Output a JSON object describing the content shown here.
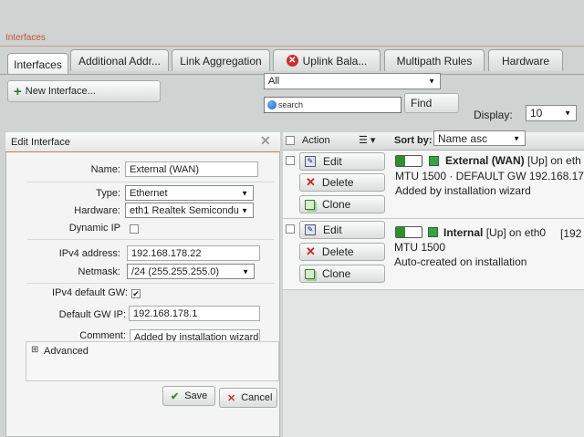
{
  "window": {
    "title": "Interfaces"
  },
  "tabs": [
    {
      "label": "Interfaces"
    },
    {
      "label": "Additional Addr..."
    },
    {
      "label": "Link Aggregation"
    },
    {
      "label": "Uplink Bala..."
    },
    {
      "label": "Multipath Rules"
    },
    {
      "label": "Hardware"
    }
  ],
  "toolbar": {
    "new_interface_label": "New Interface...",
    "filter_value": "All",
    "search_placeholder": "search",
    "find_label": "Find",
    "display_label": "Display:",
    "display_value": "10"
  },
  "edit_panel": {
    "title": "Edit Interface",
    "fields": {
      "name": {
        "label": "Name:",
        "value": "External (WAN)"
      },
      "type": {
        "label": "Type:",
        "value": "Ethernet"
      },
      "hardware": {
        "label": "Hardware:",
        "value": "eth1 Realtek Semicondu"
      },
      "dynamic_ip": {
        "label": "Dynamic IP",
        "checked": false
      },
      "ipv4_address": {
        "label": "IPv4 address:",
        "value": "192.168.178.22"
      },
      "netmask": {
        "label": "Netmask:",
        "value": "/24 (255.255.255.0)"
      },
      "ipv4_default_gw": {
        "label": "IPv4 default GW:",
        "checked": true,
        "check_glyph": "✔"
      },
      "default_gw_ip": {
        "label": "Default GW IP:",
        "value": "192.168.178.1"
      },
      "comment": {
        "label": "Comment:",
        "value": "Added by installation wizard"
      }
    },
    "advanced_label": "Advanced",
    "advanced_expander": "⊞",
    "save_label": "Save",
    "cancel_label": "Cancel"
  },
  "list": {
    "action_header": "Action",
    "sort_by_label": "Sort by:",
    "sort_value": "Name asc",
    "rows": [
      {
        "edit_label": "Edit",
        "delete_label": "Delete",
        "clone_label": "Clone",
        "name": "External (WAN)",
        "status": "[Up] on eth",
        "line2": "MTU 1500 · DEFAULT GW 192.168.17",
        "line3": "Added by installation wizard"
      },
      {
        "edit_label": "Edit",
        "delete_label": "Delete",
        "clone_label": "Clone",
        "name": "Internal",
        "status": "[Up] on eth0",
        "extra": "[192",
        "line2": "MTU 1500",
        "line3": "Auto-created on installation"
      }
    ]
  },
  "colors": {
    "accent_title": "#c5533a",
    "status_on": "#2e8f2e",
    "delete_red": "#cc2222"
  }
}
